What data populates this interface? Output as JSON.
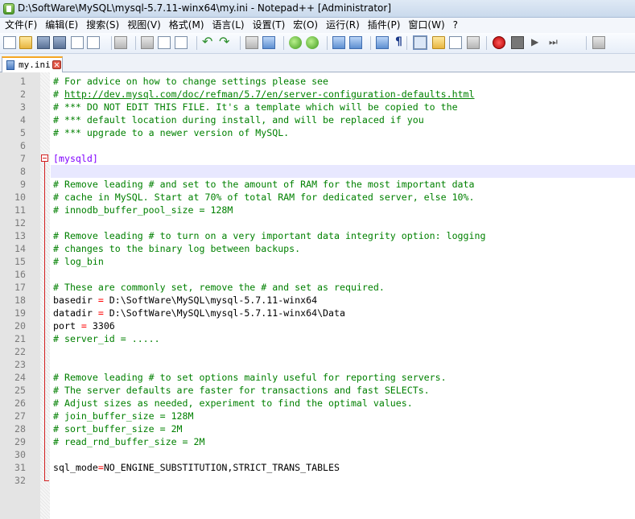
{
  "window": {
    "title": "D:\\SoftWare\\MySQL\\mysql-5.7.11-winx64\\my.ini - Notepad++ [Administrator]"
  },
  "menu": [
    {
      "label": "文件(F)"
    },
    {
      "label": "编辑(E)"
    },
    {
      "label": "搜索(S)"
    },
    {
      "label": "视图(V)"
    },
    {
      "label": "格式(M)"
    },
    {
      "label": "语言(L)"
    },
    {
      "label": "设置(T)"
    },
    {
      "label": "宏(O)"
    },
    {
      "label": "运行(R)"
    },
    {
      "label": "插件(P)"
    },
    {
      "label": "窗口(W)"
    },
    {
      "label": "?"
    }
  ],
  "toolbar": {
    "icons": [
      "new-file-icon",
      "open-file-icon",
      "save-icon",
      "save-all-icon",
      "close-icon",
      "close-all-icon",
      "print-icon",
      "cut-icon",
      "copy-icon",
      "paste-icon",
      "undo-icon",
      "redo-icon",
      "find-icon",
      "replace-icon",
      "zoom-in-icon",
      "zoom-out-icon",
      "sync-vertical-icon",
      "sync-horizontal-icon",
      "word-wrap-icon",
      "show-all-characters-icon",
      "indent-guide-icon",
      "user-language-icon",
      "document-map-icon",
      "function-list-icon",
      "record-macro-icon",
      "stop-recording-icon",
      "play-macro-icon",
      "run-macro-multiple-icon",
      "save-macro-icon"
    ]
  },
  "tab": {
    "label": "my.ini"
  },
  "editor": {
    "lines": [
      {
        "num": "1",
        "type": "comment",
        "text": "# For advice on how to change settings please see"
      },
      {
        "num": "2",
        "type": "link",
        "prefix": "# ",
        "text": "http://dev.mysql.com/doc/refman/5.7/en/server-configuration-defaults.html"
      },
      {
        "num": "3",
        "type": "comment",
        "text": "# *** DO NOT EDIT THIS FILE. It's a template which will be copied to the"
      },
      {
        "num": "4",
        "type": "comment",
        "text": "# *** default location during install, and will be replaced if you"
      },
      {
        "num": "5",
        "type": "comment",
        "text": "# *** upgrade to a newer version of MySQL."
      },
      {
        "num": "6",
        "type": "blank",
        "text": ""
      },
      {
        "num": "7",
        "type": "section",
        "text": "[mysqld]"
      },
      {
        "num": "8",
        "type": "blank",
        "text": ""
      },
      {
        "num": "9",
        "type": "comment",
        "text": "# Remove leading # and set to the amount of RAM for the most important data"
      },
      {
        "num": "10",
        "type": "comment",
        "text": "# cache in MySQL. Start at 70% of total RAM for dedicated server, else 10%."
      },
      {
        "num": "11",
        "type": "comment",
        "text": "# innodb_buffer_pool_size = 128M"
      },
      {
        "num": "12",
        "type": "blank",
        "text": ""
      },
      {
        "num": "13",
        "type": "comment",
        "text": "# Remove leading # to turn on a very important data integrity option: logging"
      },
      {
        "num": "14",
        "type": "comment",
        "text": "# changes to the binary log between backups."
      },
      {
        "num": "15",
        "type": "comment",
        "text": "# log_bin"
      },
      {
        "num": "16",
        "type": "blank",
        "text": ""
      },
      {
        "num": "17",
        "type": "comment",
        "text": "# These are commonly set, remove the # and set as required."
      },
      {
        "num": "18",
        "type": "kv",
        "key": "basedir ",
        "eq": "=",
        "val": " D:\\SoftWare\\MySQL\\mysql-5.7.11-winx64"
      },
      {
        "num": "19",
        "type": "kv",
        "key": "datadir ",
        "eq": "=",
        "val": " D:\\SoftWare\\MySQL\\mysql-5.7.11-winx64\\Data"
      },
      {
        "num": "20",
        "type": "kv",
        "key": "port ",
        "eq": "=",
        "val": " 3306"
      },
      {
        "num": "21",
        "type": "comment",
        "text": "# server_id = ....."
      },
      {
        "num": "22",
        "type": "blank",
        "text": ""
      },
      {
        "num": "23",
        "type": "blank",
        "text": ""
      },
      {
        "num": "24",
        "type": "comment",
        "text": "# Remove leading # to set options mainly useful for reporting servers."
      },
      {
        "num": "25",
        "type": "comment",
        "text": "# The server defaults are faster for transactions and fast SELECTs."
      },
      {
        "num": "26",
        "type": "comment",
        "text": "# Adjust sizes as needed, experiment to find the optimal values."
      },
      {
        "num": "27",
        "type": "comment",
        "text": "# join_buffer_size = 128M"
      },
      {
        "num": "28",
        "type": "comment",
        "text": "# sort_buffer_size = 2M"
      },
      {
        "num": "29",
        "type": "comment",
        "text": "# read_rnd_buffer_size = 2M"
      },
      {
        "num": "30",
        "type": "blank",
        "text": ""
      },
      {
        "num": "31",
        "type": "kv",
        "key": "sql_mode",
        "eq": "=",
        "val": "NO_ENGINE_SUBSTITUTION,STRICT_TRANS_TABLES"
      },
      {
        "num": "32",
        "type": "blank",
        "text": ""
      }
    ]
  }
}
